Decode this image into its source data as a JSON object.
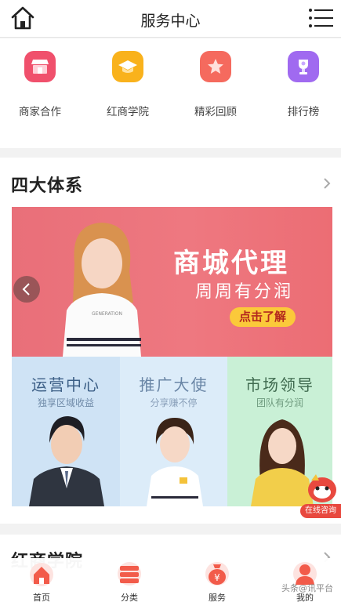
{
  "header": {
    "title": "服务中心"
  },
  "quick_links": [
    {
      "label": "商家合作",
      "icon": "shop-icon",
      "color": "#f0506c"
    },
    {
      "label": "红商学院",
      "icon": "graduation-cap-icon",
      "color": "#f9b21c"
    },
    {
      "label": "精彩回顾",
      "icon": "star-icon",
      "color": "#f56a5e"
    },
    {
      "label": "排行榜",
      "icon": "trophy-icon",
      "color": "#a06af0"
    }
  ],
  "section": {
    "title": "四大体系",
    "banner": {
      "headline": "商城代理",
      "subline": "周周有分润",
      "cta": "点击了解",
      "model_text": "GENERATION"
    },
    "columns": [
      {
        "title": "运营中心",
        "subtitle": "独享区域收益"
      },
      {
        "title": "推广大使",
        "subtitle": "分享赚不停"
      },
      {
        "title": "市场领导",
        "subtitle": "团队有分润"
      }
    ],
    "online_service": "在线咨询"
  },
  "next_section": {
    "title": "红商学院"
  },
  "tabbar": [
    {
      "label": "首页",
      "icon": "home-icon"
    },
    {
      "label": "分类",
      "icon": "category-icon"
    },
    {
      "label": "服务",
      "icon": "money-bag-icon"
    },
    {
      "label": "我的",
      "icon": "user-icon"
    }
  ],
  "watermark": "头条@讯平台",
  "colors": {
    "accent": "#e8493f",
    "banner": "#ec727a",
    "cta": "#fbc93a"
  }
}
